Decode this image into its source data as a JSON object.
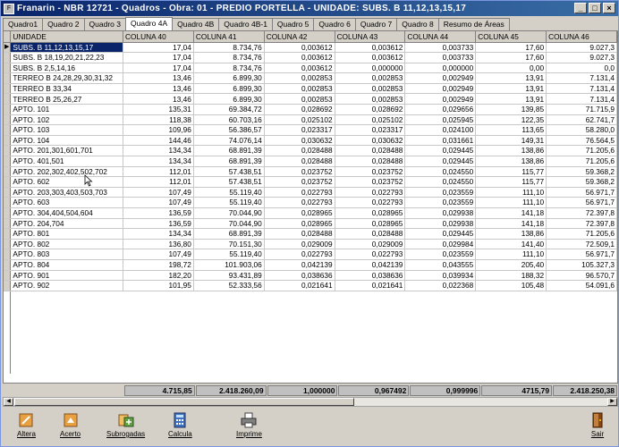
{
  "window": {
    "title": "Franarin - NBR 12721 - Quadros - Obra: 01 - PREDIO PORTELLA - UNIDADE: SUBS. B 11,12,13,15,17",
    "min_label": "_",
    "max_label": "□",
    "close_label": "×"
  },
  "tabs": [
    {
      "label": "Quadro1",
      "active": false
    },
    {
      "label": "Quadro 2",
      "active": false
    },
    {
      "label": "Quadro 3",
      "active": false
    },
    {
      "label": "Quadro 4A",
      "active": true
    },
    {
      "label": "Quadro 4B",
      "active": false
    },
    {
      "label": "Quadro 4B-1",
      "active": false
    },
    {
      "label": "Quadro 5",
      "active": false
    },
    {
      "label": "Quadro 6",
      "active": false
    },
    {
      "label": "Quadro 7",
      "active": false
    },
    {
      "label": "Quadro 8",
      "active": false
    },
    {
      "label": "Resumo de Áreas",
      "active": false
    }
  ],
  "grid": {
    "selected_indicator": "▶",
    "columns": [
      "UNIDADE",
      "COLUNA 40",
      "COLUNA 41",
      "COLUNA 42",
      "COLUNA 43",
      "COLUNA 44",
      "COLUNA 45",
      "COLUNA 46"
    ],
    "rows": [
      [
        "SUBS. B 11,12,13,15,17",
        "17,04",
        "8.734,76",
        "0,003612",
        "0,003612",
        "0,003733",
        "17,60",
        "9.027,3"
      ],
      [
        "SUBS. B 18,19,20,21,22,23",
        "17,04",
        "8.734,76",
        "0,003612",
        "0,003612",
        "0,003733",
        "17,60",
        "9.027,3"
      ],
      [
        "SUBS. B 2,5,14,16",
        "17,04",
        "8.734,76",
        "0,003612",
        "0,000000",
        "0,000000",
        "0,00",
        "0,0"
      ],
      [
        "TERREO B 24,28,29,30,31,32",
        "13,46",
        "6.899,30",
        "0,002853",
        "0,002853",
        "0,002949",
        "13,91",
        "7.131,4"
      ],
      [
        "TERREO B 33,34",
        "13,46",
        "6.899,30",
        "0,002853",
        "0,002853",
        "0,002949",
        "13,91",
        "7.131,4"
      ],
      [
        "TERREO B 25,26,27",
        "13,46",
        "6.899,30",
        "0,002853",
        "0,002853",
        "0,002949",
        "13,91",
        "7.131,4"
      ],
      [
        "APTO. 101",
        "135,31",
        "69.384,72",
        "0,028692",
        "0,028692",
        "0,029656",
        "139,85",
        "71.715,9"
      ],
      [
        "APTO. 102",
        "118,38",
        "60.703,16",
        "0,025102",
        "0,025102",
        "0,025945",
        "122,35",
        "62.741,7"
      ],
      [
        "APTO. 103",
        "109,96",
        "56.386,57",
        "0,023317",
        "0,023317",
        "0,024100",
        "113,65",
        "58.280,0"
      ],
      [
        "APTO. 104",
        "144,46",
        "74.076,14",
        "0,030632",
        "0,030632",
        "0,031661",
        "149,31",
        "76.564,5"
      ],
      [
        "APTO. 201,301,601,701",
        "134,34",
        "68.891,39",
        "0,028488",
        "0,028488",
        "0,029445",
        "138,86",
        "71.205,6"
      ],
      [
        "APTO. 401,501",
        "134,34",
        "68.891,39",
        "0,028488",
        "0,028488",
        "0,029445",
        "138,86",
        "71.205,6"
      ],
      [
        "APTO. 202,302,402,502,702",
        "112,01",
        "57.438,51",
        "0,023752",
        "0,023752",
        "0,024550",
        "115,77",
        "59.368,2"
      ],
      [
        "APTO. 602",
        "112,01",
        "57.438,51",
        "0,023752",
        "0,023752",
        "0,024550",
        "115,77",
        "59.368,2"
      ],
      [
        "APTO. 203,303,403,503,703",
        "107,49",
        "55.119,40",
        "0,022793",
        "0,022793",
        "0,023559",
        "111,10",
        "56.971,7"
      ],
      [
        "APTO. 603",
        "107,49",
        "55.119,40",
        "0,022793",
        "0,022793",
        "0,023559",
        "111,10",
        "56.971,7"
      ],
      [
        "APTO. 304,404,504,604",
        "136,59",
        "70.044,90",
        "0,028965",
        "0,028965",
        "0,029938",
        "141,18",
        "72.397,8"
      ],
      [
        "APTO. 204,704",
        "136,59",
        "70.044,90",
        "0,028965",
        "0,028965",
        "0,029938",
        "141,18",
        "72.397,8"
      ],
      [
        "APTO. 801",
        "134,34",
        "68.891,39",
        "0,028488",
        "0,028488",
        "0,029445",
        "138,86",
        "71.205,6"
      ],
      [
        "APTO. 802",
        "136,80",
        "70.151,30",
        "0,029009",
        "0,029009",
        "0,029984",
        "141,40",
        "72.509,1"
      ],
      [
        "APTO. 803",
        "107,49",
        "55.119,40",
        "0,022793",
        "0,022793",
        "0,023559",
        "111,10",
        "56.971,7"
      ],
      [
        "APTO. 804",
        "198,72",
        "101.903,06",
        "0,042139",
        "0,042139",
        "0,043555",
        "205,40",
        "105.327,3"
      ],
      [
        "APTO. 901",
        "182,20",
        "93.431,89",
        "0,038636",
        "0,038636",
        "0,039934",
        "188,32",
        "96.570,7"
      ],
      [
        "APTO. 902",
        "101,95",
        "52.333,56",
        "0,021641",
        "0,021641",
        "0,022368",
        "105,48",
        "54.091,6"
      ]
    ],
    "selected_row": 0
  },
  "totals": [
    "4.715,85",
    "2.418.260,09",
    "1,000000",
    "0,967492",
    "0,999996",
    "4715,79",
    "2.418.250,38"
  ],
  "scrollbar": {
    "left_arrow": "◀",
    "right_arrow": "▶"
  },
  "toolbar": {
    "altera": "Altera",
    "acerto": "Acerto",
    "subrogadas": "Subrogadas",
    "calcula": "Calcula",
    "imprime": "Imprime",
    "sair": "Sair"
  },
  "colors": {
    "titlebar_start": "#0a246a",
    "selection": "#0a246a",
    "face": "#d4d0c8"
  }
}
